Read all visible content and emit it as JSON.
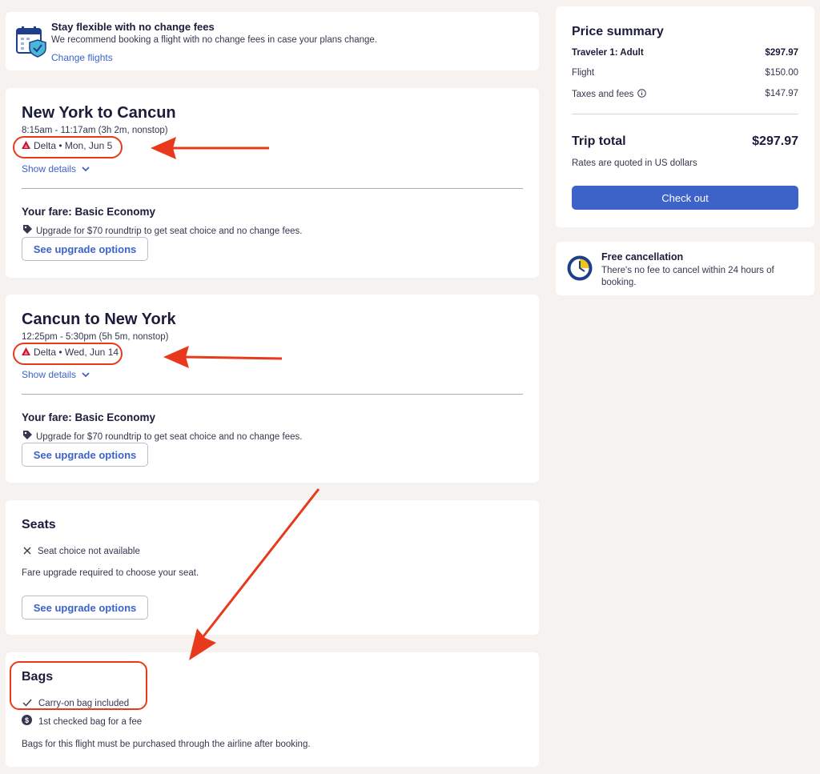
{
  "flexible": {
    "title": "Stay flexible with no change fees",
    "description": "We recommend booking a flight with no change fees in case your plans change.",
    "link": "Change flights"
  },
  "flight1": {
    "route": "New York to Cancun",
    "times": "8:15am - 11:17am (3h 2m, nonstop)",
    "airline_date": "Delta • Mon, Jun 5",
    "show_details": "Show details",
    "fare_title": "Your fare: Basic Economy",
    "upgrade_text": "Upgrade for $70 roundtrip to get seat choice and no change fees.",
    "upgrade_button": "See upgrade options"
  },
  "flight2": {
    "route": "Cancun to New York",
    "times": "12:25pm - 5:30pm (5h 5m, nonstop)",
    "airline_date": "Delta • Wed, Jun 14",
    "show_details": "Show details",
    "fare_title": "Your fare: Basic Economy",
    "upgrade_text": "Upgrade for $70 roundtrip to get seat choice and no change fees.",
    "upgrade_button": "See upgrade options"
  },
  "seats": {
    "title": "Seats",
    "not_available": "Seat choice not available",
    "note": "Fare upgrade required to choose your seat.",
    "upgrade_button": "See upgrade options"
  },
  "bags": {
    "title": "Bags",
    "carry_on": "Carry-on bag included",
    "checked": "1st checked bag for a fee",
    "note": "Bags for this flight must be purchased through the airline after booking."
  },
  "price_summary": {
    "title": "Price summary",
    "traveler_label": "Traveler 1: Adult",
    "traveler_value": "$297.97",
    "flight_label": "Flight",
    "flight_value": "$150.00",
    "taxes_label": "Taxes and fees",
    "taxes_value": "$147.97",
    "total_label": "Trip total",
    "total_value": "$297.97",
    "currency_note": "Rates are quoted in US dollars",
    "checkout_button": "Check out"
  },
  "free_cancellation": {
    "title": "Free cancellation",
    "description": "There's no fee to cancel within 24 hours of booking."
  },
  "colors": {
    "accent": "#3d63c9",
    "annotation_red": "#e8391d",
    "delta_red": "#c8102e",
    "background": "#f5f2f0"
  },
  "icons": {
    "calendar_shield": "calendar-shield-icon",
    "delta_logo": "delta-logo-icon",
    "chevron": "chevron-down-icon",
    "tag": "tag-icon",
    "close": "close-icon",
    "check": "check-icon",
    "dollar": "dollar-circle-icon",
    "info": "info-icon",
    "clock": "clock-icon"
  }
}
